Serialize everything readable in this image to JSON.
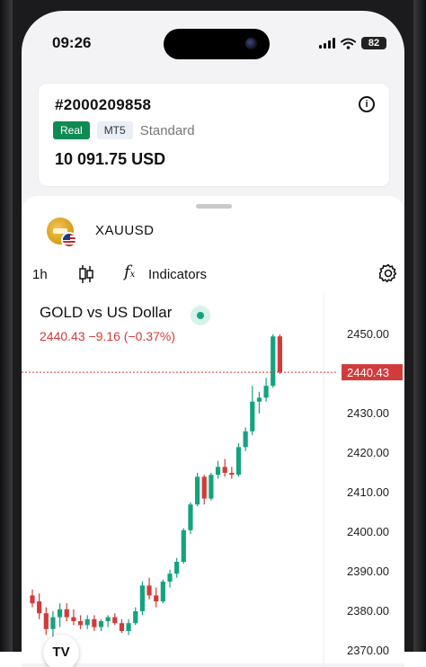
{
  "status_bar": {
    "time": "09:26",
    "battery": "82"
  },
  "account": {
    "id": "#2000209858",
    "tag_real": "Real",
    "tag_platform": "MT5",
    "tag_type": "Standard",
    "balance": "10 091.75 USD"
  },
  "symbol": {
    "name": "XAUUSD"
  },
  "toolbar": {
    "timeframe": "1h",
    "indicators_label": "Indicators"
  },
  "chart_header": {
    "title": "GOLD vs US Dollar",
    "quote": "2440.43 −9.16 (−0.37%)"
  },
  "colors": {
    "up": "#14a37f",
    "down": "#d23b3b",
    "accent_green": "#0f8a52"
  },
  "chart_data": {
    "type": "candlestick",
    "title": "GOLD vs US Dollar",
    "ylim": [
      2370,
      2454
    ],
    "yticks": [
      "2450.00",
      "2440.00",
      "2430.00",
      "2420.00",
      "2410.00",
      "2400.00",
      "2390.00",
      "2380.00",
      "2370.00"
    ],
    "last_price": "2440.43",
    "candles": [
      {
        "o": 2384.0,
        "h": 2385.5,
        "l": 2381.0,
        "c": 2382.0
      },
      {
        "o": 2382.5,
        "h": 2384.5,
        "l": 2378.0,
        "c": 2379.5
      },
      {
        "o": 2379.5,
        "h": 2381.0,
        "l": 2374.0,
        "c": 2375.5
      },
      {
        "o": 2375.5,
        "h": 2380.0,
        "l": 2373.0,
        "c": 2378.5
      },
      {
        "o": 2378.5,
        "h": 2382.0,
        "l": 2376.0,
        "c": 2380.5
      },
      {
        "o": 2380.5,
        "h": 2382.0,
        "l": 2377.5,
        "c": 2378.5
      },
      {
        "o": 2378.5,
        "h": 2380.5,
        "l": 2376.5,
        "c": 2377.5
      },
      {
        "o": 2377.5,
        "h": 2379.0,
        "l": 2375.5,
        "c": 2376.5
      },
      {
        "o": 2376.5,
        "h": 2379.0,
        "l": 2375.5,
        "c": 2378.0
      },
      {
        "o": 2378.0,
        "h": 2379.0,
        "l": 2375.0,
        "c": 2376.0
      },
      {
        "o": 2376.0,
        "h": 2378.0,
        "l": 2375.0,
        "c": 2377.5
      },
      {
        "o": 2377.5,
        "h": 2379.0,
        "l": 2376.0,
        "c": 2378.5
      },
      {
        "o": 2378.5,
        "h": 2379.5,
        "l": 2376.5,
        "c": 2377.0
      },
      {
        "o": 2377.0,
        "h": 2378.0,
        "l": 2374.5,
        "c": 2375.0
      },
      {
        "o": 2375.0,
        "h": 2378.0,
        "l": 2374.0,
        "c": 2377.0
      },
      {
        "o": 2377.0,
        "h": 2381.0,
        "l": 2376.5,
        "c": 2380.0
      },
      {
        "o": 2380.0,
        "h": 2387.5,
        "l": 2379.0,
        "c": 2386.5
      },
      {
        "o": 2386.5,
        "h": 2388.5,
        "l": 2383.0,
        "c": 2384.0
      },
      {
        "o": 2384.0,
        "h": 2386.0,
        "l": 2381.0,
        "c": 2382.5
      },
      {
        "o": 2382.5,
        "h": 2388.0,
        "l": 2382.0,
        "c": 2387.5
      },
      {
        "o": 2387.5,
        "h": 2390.5,
        "l": 2386.0,
        "c": 2389.5
      },
      {
        "o": 2389.5,
        "h": 2393.5,
        "l": 2388.5,
        "c": 2392.5
      },
      {
        "o": 2392.5,
        "h": 2401.0,
        "l": 2392.0,
        "c": 2400.5
      },
      {
        "o": 2400.5,
        "h": 2407.5,
        "l": 2399.5,
        "c": 2407.0
      },
      {
        "o": 2407.0,
        "h": 2415.0,
        "l": 2406.5,
        "c": 2414.0
      },
      {
        "o": 2414.0,
        "h": 2414.5,
        "l": 2407.0,
        "c": 2408.5
      },
      {
        "o": 2408.5,
        "h": 2415.0,
        "l": 2408.0,
        "c": 2414.5
      },
      {
        "o": 2414.5,
        "h": 2418.0,
        "l": 2413.5,
        "c": 2416.5
      },
      {
        "o": 2416.5,
        "h": 2418.5,
        "l": 2414.0,
        "c": 2415.0
      },
      {
        "o": 2415.0,
        "h": 2416.5,
        "l": 2413.5,
        "c": 2414.5
      },
      {
        "o": 2414.5,
        "h": 2422.5,
        "l": 2414.0,
        "c": 2421.5
      },
      {
        "o": 2421.5,
        "h": 2426.5,
        "l": 2420.5,
        "c": 2425.5
      },
      {
        "o": 2425.5,
        "h": 2437.0,
        "l": 2424.5,
        "c": 2433.0
      },
      {
        "o": 2433.0,
        "h": 2435.5,
        "l": 2430.0,
        "c": 2434.0
      },
      {
        "o": 2434.0,
        "h": 2439.0,
        "l": 2433.0,
        "c": 2437.0
      },
      {
        "o": 2437.0,
        "h": 2450.0,
        "l": 2436.5,
        "c": 2449.5
      },
      {
        "o": 2449.5,
        "h": 2450.0,
        "l": 2440.0,
        "c": 2440.43
      }
    ]
  }
}
